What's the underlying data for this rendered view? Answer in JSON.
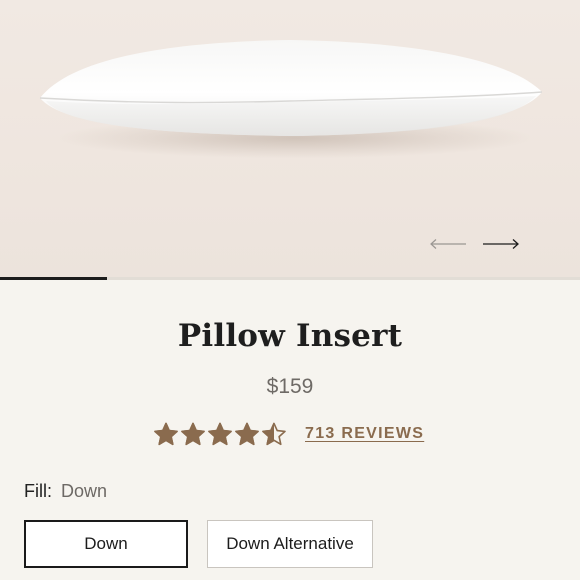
{
  "gallery": {
    "progress": 0.185,
    "prev_icon": "arrow-left-icon",
    "next_icon": "arrow-right-icon"
  },
  "product": {
    "title": "Pillow Insert",
    "price": "$159",
    "rating": 4.5,
    "rating_max": 5,
    "reviews_label": "713 REVIEWS",
    "star_color": "#8a6b4e"
  },
  "fill": {
    "label": "Fill:",
    "selected": "Down",
    "options": [
      "Down",
      "Down Alternative"
    ]
  }
}
